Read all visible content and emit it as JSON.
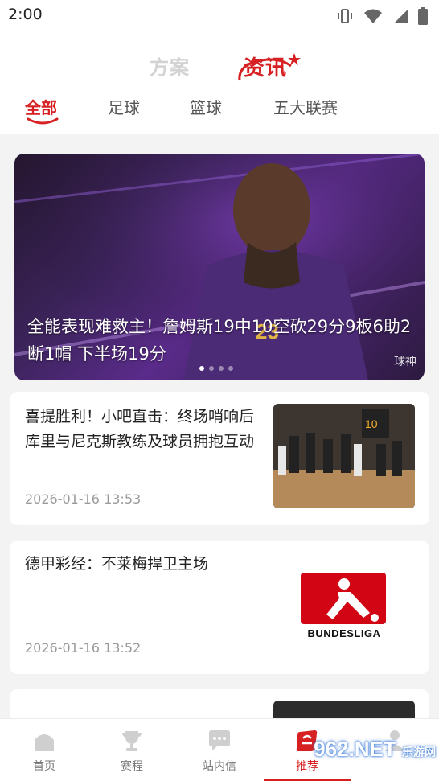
{
  "status": {
    "time": "2:00"
  },
  "segment": {
    "inactive": "方案",
    "active": "资讯"
  },
  "tabs": [
    "全部",
    "足球",
    "篮球",
    "五大联赛"
  ],
  "banner": {
    "title": "全能表现难救主！詹姆斯19中10空砍29分9板6助2断1帽 下半场19分",
    "watermark": "球神"
  },
  "articles": [
    {
      "title": "喜提胜利！小吧直击：终场哨响后库里与尼克斯教练及球员拥抱互动",
      "date": "2026-01-16 13:53"
    },
    {
      "title": "德甲彩经：不莱梅捍卫主场",
      "date": "2026-01-16 13:52",
      "thumb_text": "BUNDESLIGA"
    }
  ],
  "bottom_nav": [
    {
      "label": "首页",
      "icon": "home-icon"
    },
    {
      "label": "赛程",
      "icon": "trophy-icon"
    },
    {
      "label": "站内信",
      "icon": "message-icon"
    },
    {
      "label": "推荐",
      "icon": "recommend-icon",
      "active": true
    },
    {
      "label": "",
      "icon": "profile-icon"
    }
  ],
  "overlay_watermark": "962.NET",
  "overlay_watermark_sub": "乐游网",
  "colors": {
    "accent": "#d62022",
    "inactive_text": "#777777",
    "date_text": "#9a9a9a"
  }
}
